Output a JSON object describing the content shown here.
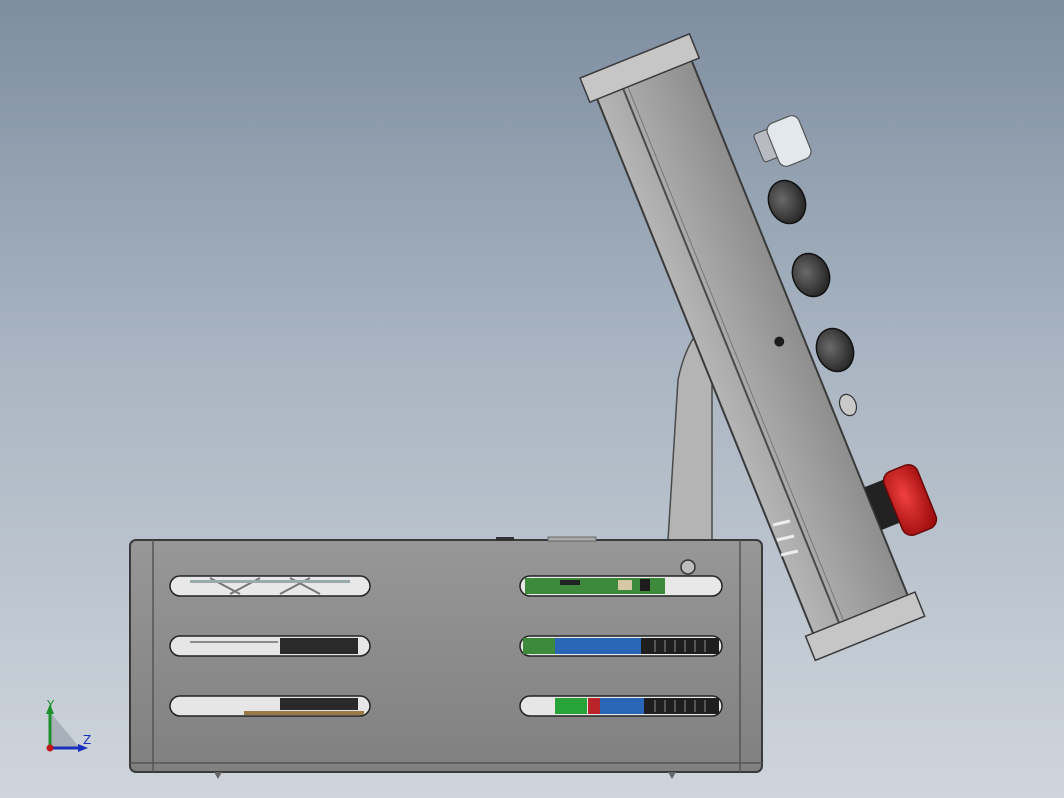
{
  "view": {
    "description_colors": {
      "background_top": "#7e8ea0",
      "background_bottom": "#cfd5dc"
    }
  },
  "triad": {
    "y_label": "Y",
    "z_label": "Z",
    "y_color": "#1a8f2a",
    "z_color": "#1b2fbf",
    "origin_color": "#c0161b"
  },
  "model": {
    "enclosure_color": "#8a8a8a",
    "pendant_color": "#9b9b9b",
    "estop_color": "#d51616",
    "knob_color": "#2d2d2d",
    "pcb_color": "#3d8a3d"
  }
}
